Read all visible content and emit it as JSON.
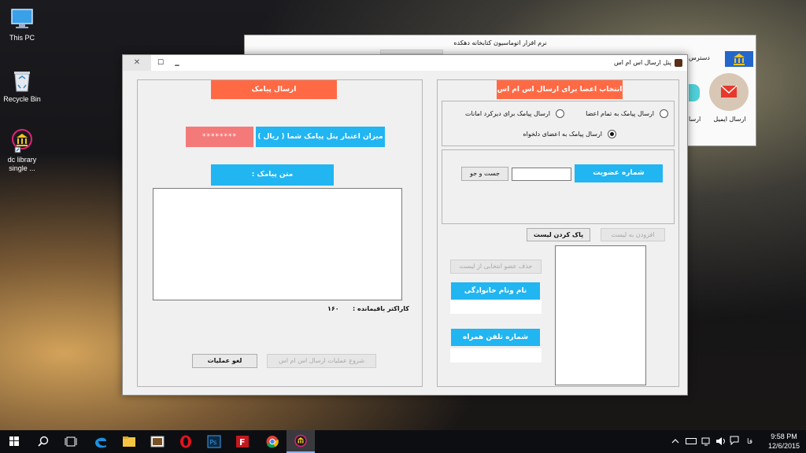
{
  "desktop": {
    "icons": [
      {
        "label": "This PC"
      },
      {
        "label": "Recycle Bin"
      },
      {
        "label": "dc library single ..."
      }
    ]
  },
  "back_window": {
    "title": "نرم افزار اتوماسیون کتابخانه دهکده",
    "menu_label": "دسترس",
    "tile_email_label": "ارسال ایمیل",
    "tile_partial_label": "ارسا"
  },
  "sms_window": {
    "title": "پنل ارسال اس ام اس",
    "close_glyph": "✕",
    "maximize_glyph": "☐",
    "minimize_glyph": "▁",
    "left": {
      "header": "ارسال پیامک",
      "credit_label": "میزان اعتبار پنل پیامک شما ( ریال )",
      "credit_value": "********",
      "message_label": "متن پیامک :",
      "message_text": "",
      "remaining_label": "کاراکتر باقیمانده :",
      "remaining_value": "۱۶۰",
      "cancel_button": "لغو عملیات",
      "start_button": "شروع عملیات ارسال اس ام اس"
    },
    "right": {
      "header": "انتخاب اعضا برای ارسال اس ام اس",
      "radio_all": "ارسال پیامک به تمام اعضا",
      "radio_overdue": "ارسال پیامک برای دیرکرد امانات",
      "radio_selected": "ارسال پیامک به اعضای دلخواه",
      "selected_option": "radio_selected",
      "member_number_label": "شماره عضویت",
      "member_number_value": "",
      "search_button": "جست و جو",
      "add_to_list_button": "افزودن به لیست",
      "clear_list_button": "پاک کردن لیست",
      "remove_selected_button": "حذف عضو انتخابی از لیست",
      "full_name_label": "نام ونام خانوادگی",
      "full_name_value": "",
      "mobile_label": "شماره تلفن همراه",
      "mobile_value": ""
    }
  },
  "taskbar": {
    "apps": [
      "start-icon",
      "search-icon",
      "task-view-icon",
      "edge-icon",
      "file-explorer-icon",
      "picture-viewer-icon",
      "opera-icon",
      "photoshop-icon",
      "filezilla-icon",
      "chrome-icon",
      "library-app-icon"
    ],
    "language": "فا",
    "time": "9:58 PM",
    "date": "12/6/2015"
  },
  "colors": {
    "accent_orange": "#ff6a45",
    "accent_blue": "#21b5f2",
    "credit_pink": "#f47a7a"
  }
}
